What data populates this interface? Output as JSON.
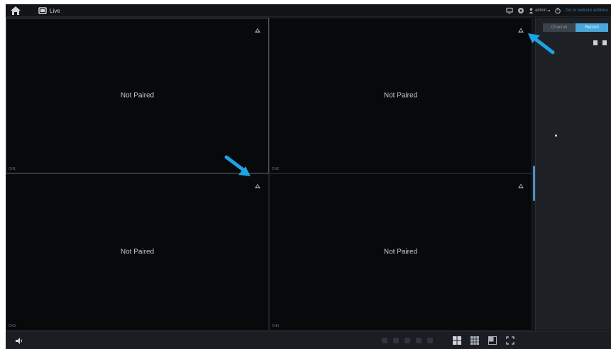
{
  "header": {
    "tab_label": "Live",
    "user_label": "admin",
    "link_text": "Go to website address"
  },
  "tiles": [
    {
      "message": "Not Paired",
      "channel": "CH1"
    },
    {
      "message": "Not Paired",
      "channel": "CH2"
    },
    {
      "message": "Not Paired",
      "channel": "CH3"
    },
    {
      "message": "Not Paired",
      "channel": "CH4"
    }
  ],
  "panel": {
    "tabs": [
      "Channel",
      "Record"
    ],
    "active_tab_index": 1
  },
  "colors": {
    "accent": "#4aa7dc",
    "annotation_arrow": "#1ea2e6",
    "background": "#14171a"
  },
  "icons": [
    "home-icon",
    "camera-icon",
    "monitor-icon",
    "globe-icon",
    "user-icon",
    "power-icon",
    "pair-icon",
    "volume-icon",
    "layout-icon"
  ]
}
